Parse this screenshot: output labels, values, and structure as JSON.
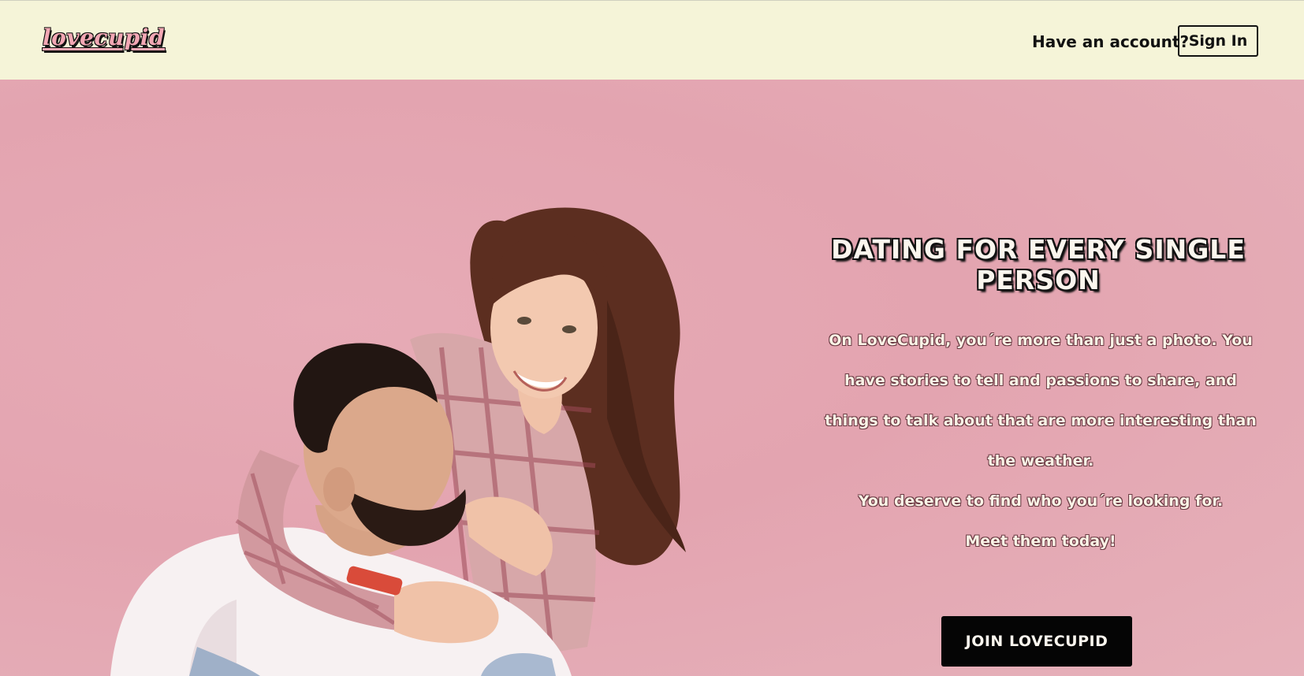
{
  "header": {
    "logo_text": "lovecupid",
    "have_account_text": "Have an account?",
    "signin_label": "Sign In"
  },
  "hero": {
    "headline": "DATING FOR EVERY SINGLE PERSON",
    "paragraph_1": "On LoveCupid, you´re more than just a photo. You have stories to tell and passions to share, and things to talk about that are more interesting than the weather.",
    "paragraph_2": "You deserve to find who you´re looking for.",
    "paragraph_3": "Meet them today!",
    "join_label": "JOIN LOVECUPID",
    "photo_subject": "smiling-couple-piggyback-photo"
  },
  "colors": {
    "header_bg": "#f5f4d8",
    "hero_bg": "#e4a8b3",
    "button_bg": "#050505",
    "logo_pink": "#f2a7b4"
  }
}
